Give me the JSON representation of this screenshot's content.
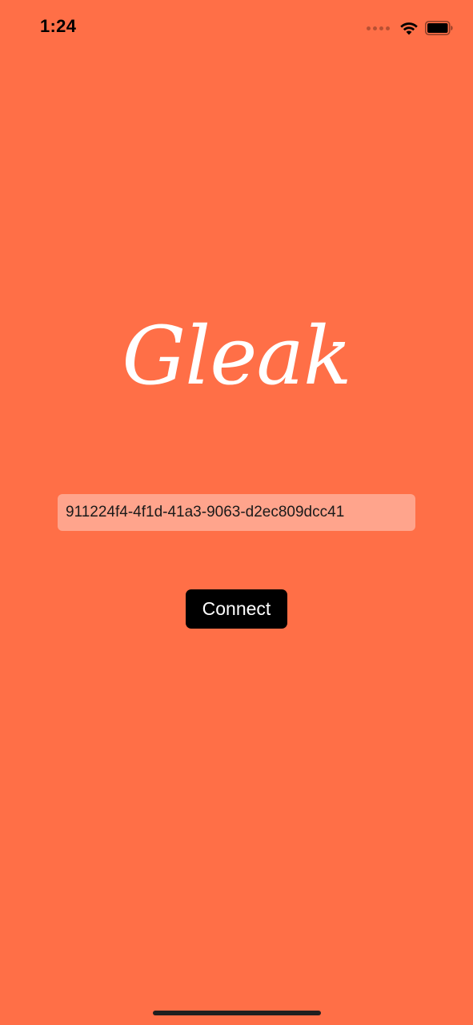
{
  "status_bar": {
    "time": "1:24",
    "icons": [
      "signal-icon",
      "wifi-icon",
      "battery-icon"
    ]
  },
  "app": {
    "logo_text": "Gleak",
    "background_color": "#FF6F47"
  },
  "session_input": {
    "value": "911224f4-4f1d-41a3-9063-d2ec809dcc41",
    "placeholder": ""
  },
  "connect_button": {
    "label": "Connect"
  }
}
